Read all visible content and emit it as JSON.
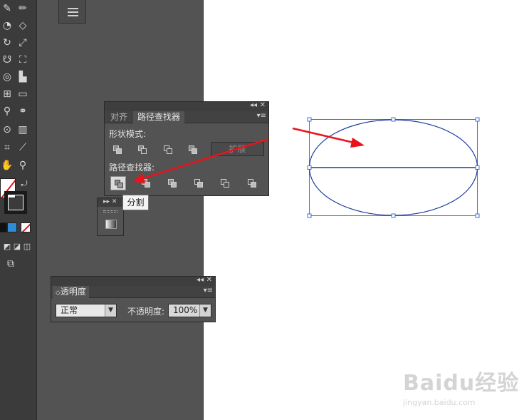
{
  "pathfinder_panel": {
    "tabs": [
      "对齐",
      "路径查找器"
    ],
    "active_tab": 1,
    "shape_modes_label": "形状模式:",
    "pathfinders_label": "路径查找器:",
    "expand_label": "扩展",
    "divide_tooltip": "分割",
    "window_controls": {
      "collapse": "◂◂",
      "close": "✕"
    },
    "menu_icon": "▾≡"
  },
  "transparency_panel": {
    "tab": "透明度",
    "tab_prefix": "◇",
    "blend_mode": "正常",
    "opacity_label": "不透明度:",
    "opacity_value": "100%",
    "window_controls": {
      "collapse": "◂◂",
      "close": "✕"
    },
    "menu_icon": "▾≡"
  },
  "mini_panel": {
    "controls": "▸▸ ✕"
  },
  "dropdown_arrow": "▼",
  "colors": {
    "arrow_red": "#e8141b",
    "ellipse_stroke": "#1a3a9c",
    "selection_blue": "#2e7bd8",
    "panel_bg": "#535353",
    "toolbar_bg": "#3b3b3b"
  },
  "watermark": {
    "main": "Baidu经验",
    "sub": "jingyan.baidu.com"
  }
}
